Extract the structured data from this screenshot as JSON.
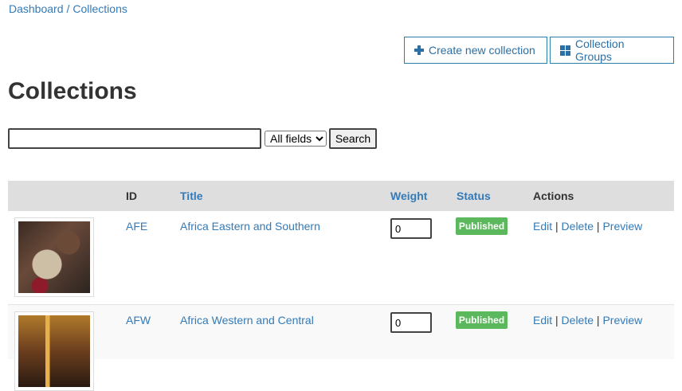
{
  "breadcrumb": {
    "dashboard": "Dashboard",
    "separator": "/",
    "collections": "Collections"
  },
  "buttons": {
    "create": "Create new collection",
    "groups": "Collection Groups"
  },
  "page": {
    "title": "Collections"
  },
  "search": {
    "value": "",
    "select_value": "All fields",
    "button": "Search"
  },
  "table": {
    "headers": {
      "id": "ID",
      "title": "Title",
      "weight": "Weight",
      "status": "Status",
      "actions": "Actions"
    },
    "rows": [
      {
        "id": "AFE",
        "title": "Africa Eastern and Southern",
        "weight": "0",
        "status": "Published",
        "edit": "Edit",
        "delete": "Delete",
        "preview": "Preview"
      },
      {
        "id": "AFW",
        "title": "Africa Western and Central",
        "weight": "0",
        "status": "Published",
        "edit": "Edit",
        "delete": "Delete",
        "preview": "Preview"
      }
    ],
    "action_separator": "|"
  },
  "colors": {
    "link": "#337ab7",
    "published": "#5cb85c",
    "header_bg": "#dedede",
    "button_border": "#2a7fa8"
  },
  "icons": {
    "create": "plus-icon",
    "groups": "grid-icon"
  }
}
